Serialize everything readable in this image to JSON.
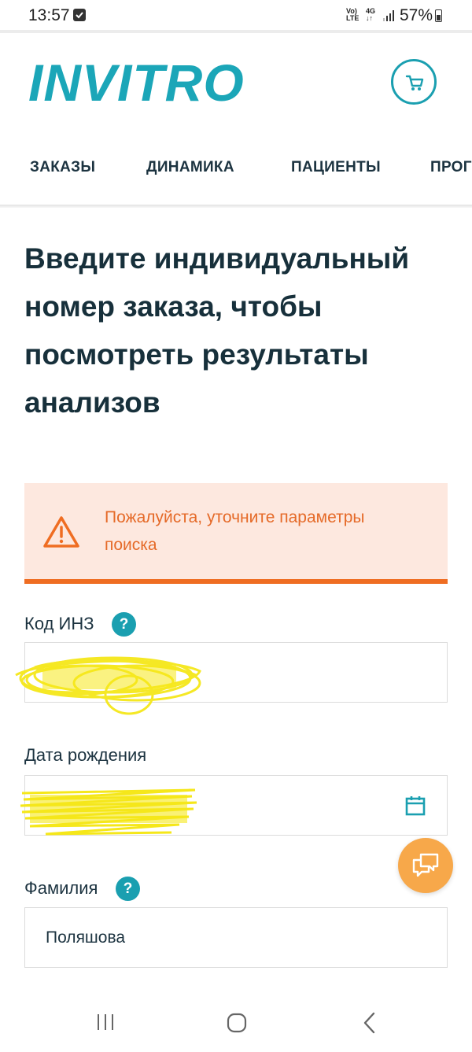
{
  "status_bar": {
    "time": "13:57",
    "network_top": "Vo)",
    "network_bottom": "LTE",
    "gen_top": "4G",
    "gen_bottom": "↓↑",
    "battery": "57%"
  },
  "header": {
    "logo": "INVITRO",
    "cart_icon": "cart-icon",
    "accent_color": "#1ba6b8"
  },
  "nav": {
    "items": [
      {
        "label": "ЗАКАЗЫ"
      },
      {
        "label": "ДИНАМИКА"
      },
      {
        "label": "ПАЦИЕНТЫ"
      },
      {
        "label": "ПРОГ"
      }
    ]
  },
  "main": {
    "title": "Введите индивидуальный номер заказа, чтобы посмотреть результаты анализов",
    "alert": {
      "text": "Пожалуйста, уточните параметры поиска",
      "color": "#ef6d22"
    },
    "fields": [
      {
        "label": "Код ИНЗ",
        "help": "?",
        "value": ""
      },
      {
        "label": "Дата рождения",
        "value": ""
      },
      {
        "label": "Фамилия",
        "help": "?",
        "value": "Поляшова"
      }
    ]
  },
  "chat_button": {
    "icon": "chat-icon",
    "color": "#f7a84a"
  },
  "android_nav": {
    "recents": "recents-icon",
    "home": "home-icon",
    "back": "back-icon"
  }
}
